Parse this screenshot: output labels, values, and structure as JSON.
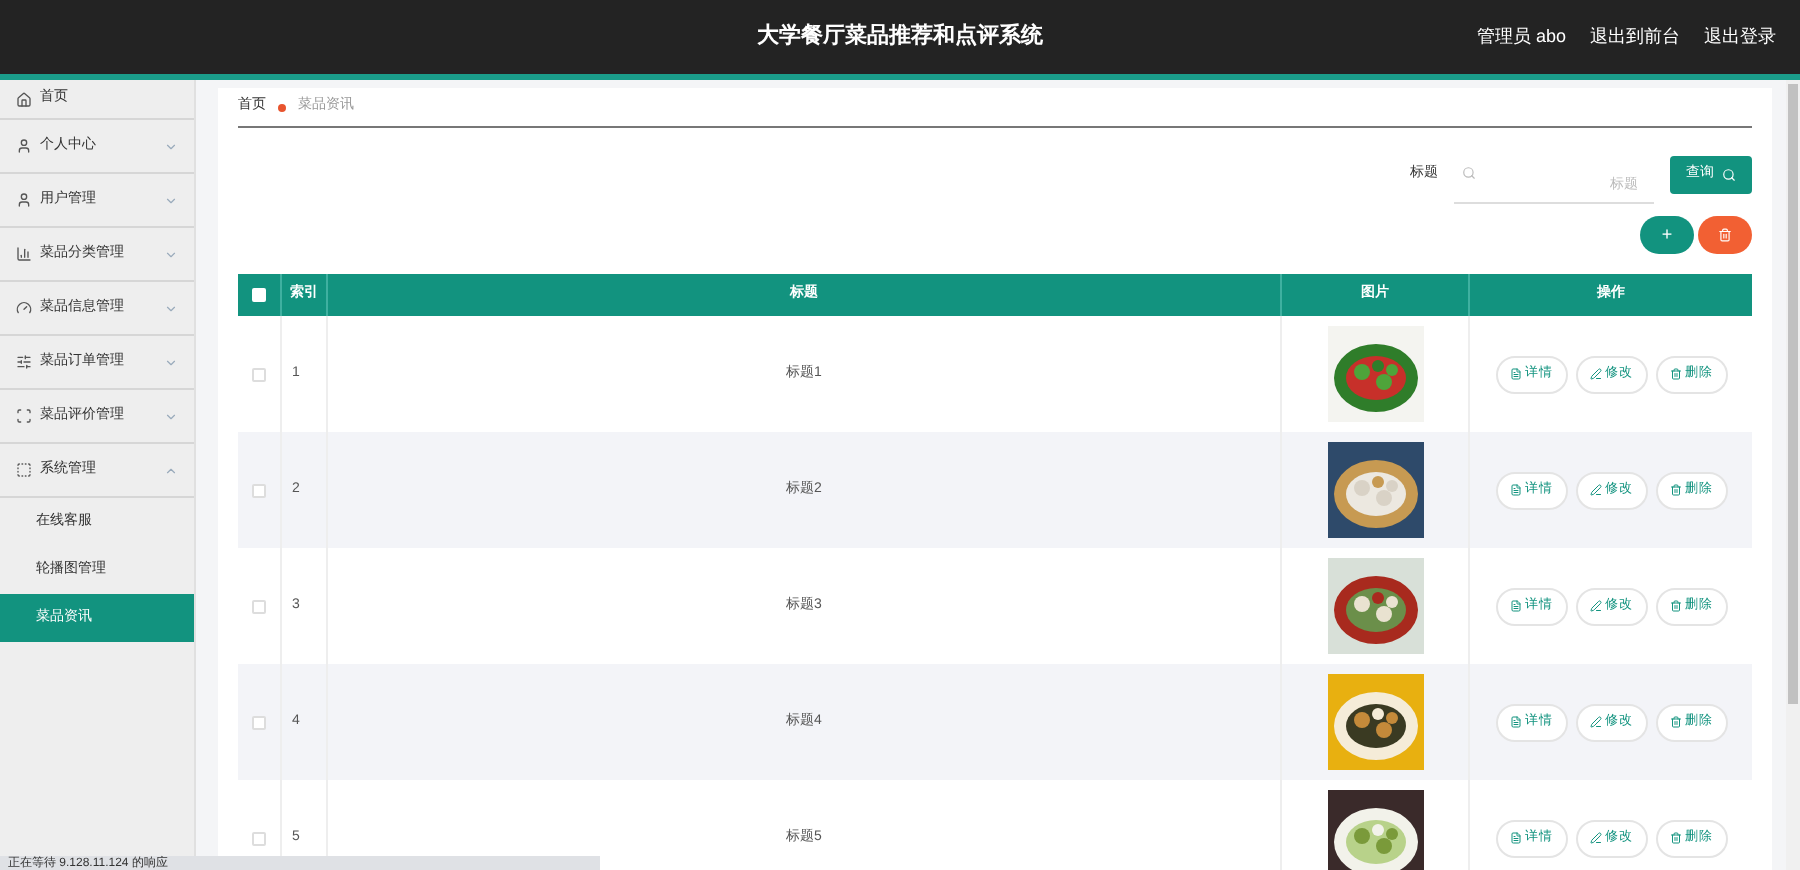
{
  "header": {
    "title": "大学餐厅菜品推荐和点评系统",
    "links": [
      "管理员 abo",
      "退出到前台",
      "退出登录"
    ]
  },
  "sidebar": {
    "items": [
      {
        "label": "首页",
        "kind": "link",
        "selected": false
      },
      {
        "label": "个人中心",
        "kind": "group",
        "expanded": false,
        "selected": false
      },
      {
        "label": "用户管理",
        "kind": "group",
        "expanded": false,
        "selected": false
      },
      {
        "label": "菜品分类管理",
        "kind": "group",
        "expanded": false,
        "selected": false
      },
      {
        "label": "菜品信息管理",
        "kind": "group",
        "expanded": false,
        "selected": false
      },
      {
        "label": "菜品订单管理",
        "kind": "group",
        "expanded": false,
        "selected": false
      },
      {
        "label": "菜品评价管理",
        "kind": "group",
        "expanded": false,
        "selected": false
      },
      {
        "label": "系统管理",
        "kind": "group",
        "expanded": true,
        "selected": false,
        "children": [
          {
            "label": "在线客服",
            "selected": false
          },
          {
            "label": "轮播图管理",
            "selected": false
          },
          {
            "label": "菜品资讯",
            "selected": true
          }
        ]
      }
    ]
  },
  "breadcrumb": [
    "首页",
    "菜品资讯"
  ],
  "search": {
    "label": "标题",
    "placeholder": "标题",
    "button": "查询"
  },
  "actions": {
    "add": "+"
  },
  "table": {
    "all_checked": false,
    "columns": [
      "索引",
      "标题",
      "图片",
      "操作"
    ],
    "rows": [
      {
        "index": "1",
        "title": "标题1",
        "checked": false,
        "picture": {
          "kind": "picture"
        },
        "buttons": [
          "详情",
          "修改",
          "删除"
        ]
      },
      {
        "index": "2",
        "title": "标题2",
        "checked": false,
        "picture": {
          "kind": "picture"
        },
        "buttons": [
          "详情",
          "修改",
          "删除"
        ]
      },
      {
        "index": "3",
        "title": "标题3",
        "checked": false,
        "picture": {
          "kind": "picture"
        },
        "buttons": [
          "详情",
          "修改",
          "删除"
        ]
      },
      {
        "index": "4",
        "title": "标题4",
        "checked": false,
        "picture": {
          "kind": "picture"
        },
        "buttons": [
          "详情",
          "修改",
          "删除"
        ]
      },
      {
        "index": "5",
        "title": "标题5",
        "checked": false,
        "picture": {
          "kind": "picture"
        },
        "buttons": [
          "详情",
          "修改",
          "删除"
        ]
      }
    ]
  },
  "status_bar": "正在等待 9.128.11.124 的响应"
}
